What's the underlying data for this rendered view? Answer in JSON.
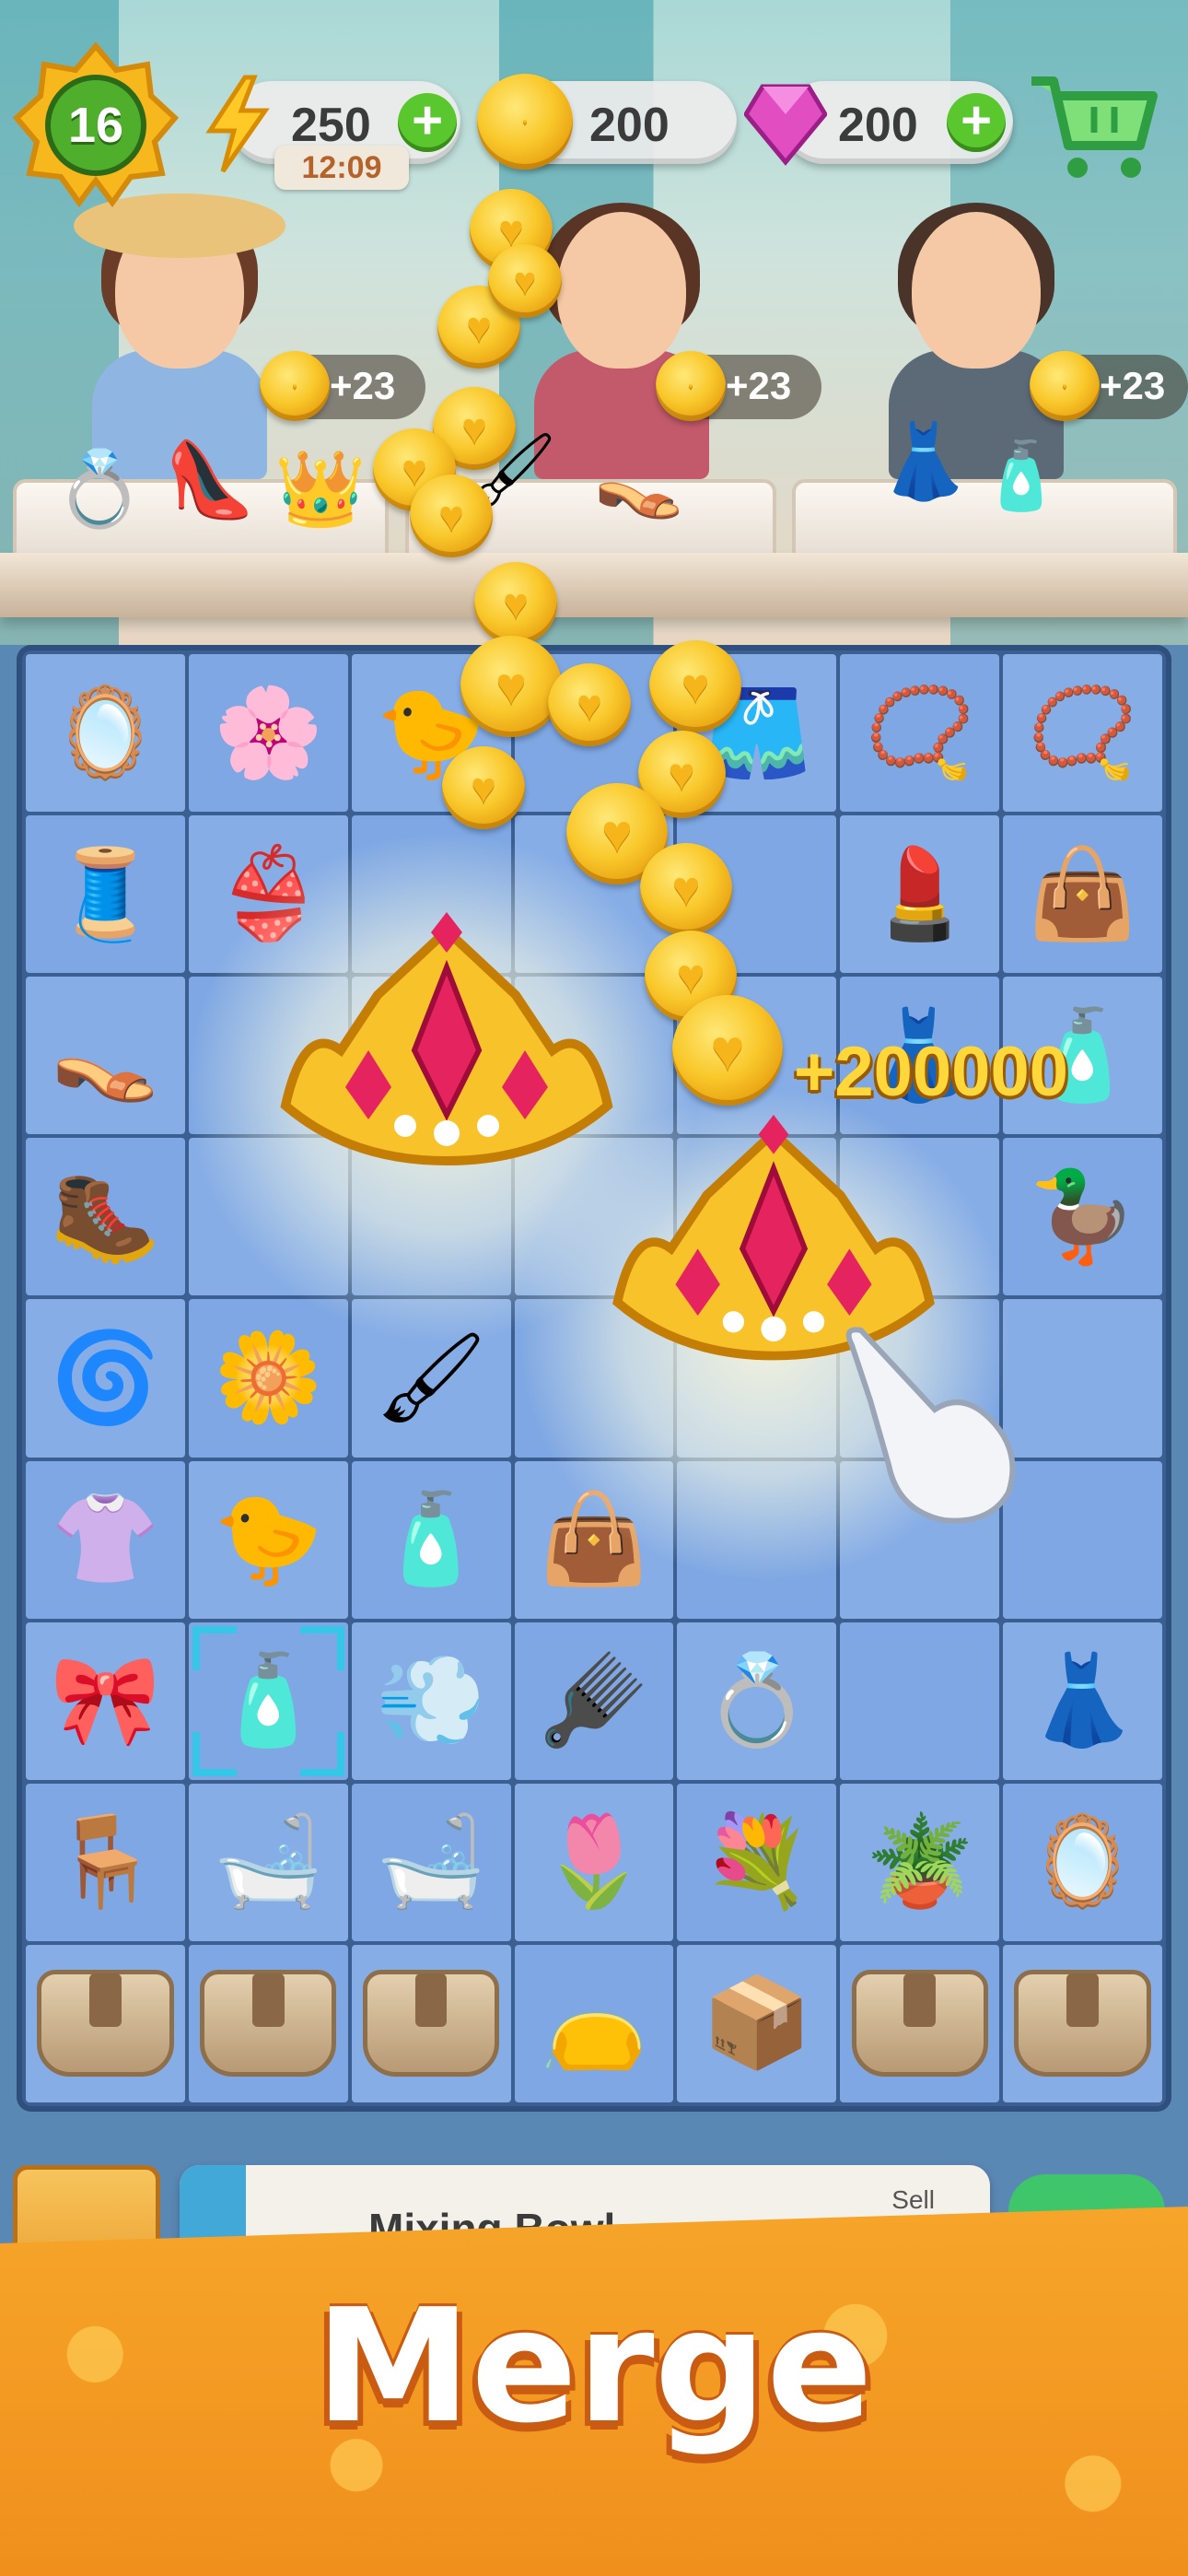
{
  "hud": {
    "level": "16",
    "energy": "250",
    "energy_timer": "12:09",
    "coins": "200",
    "gems": "200"
  },
  "customers": [
    {
      "reward": "+23"
    },
    {
      "reward": "+23"
    },
    {
      "reward": "+23"
    }
  ],
  "board": {
    "bonus": "+200000",
    "icons": {
      "r0": [
        "compact-powder-icon",
        "flower-icon",
        "rubber-duck-icon",
        "",
        "skirt-icon",
        "earrings-icon",
        "pearl-bracelet-icon"
      ],
      "r1": [
        "thread-spool-icon",
        "bra-icon",
        "",
        "",
        "",
        "lipstick-icon",
        "handbag-icon"
      ],
      "r2": [
        "sandals-icon",
        "",
        "",
        "",
        "",
        "dress-icon",
        "perfume-icon"
      ],
      "r3": [
        "boots-icon",
        "",
        "",
        "",
        "",
        "",
        "duck-float-icon"
      ],
      "r4": [
        "flower-clip-icon",
        "flower-compact-icon",
        "brush-icon",
        "",
        "",
        "",
        ""
      ],
      "r5": [
        "blouse-icon",
        "rubber-duck-icon",
        "perfume-icon",
        "handbag-icon",
        "",
        "",
        ""
      ],
      "r6": [
        "perfume-bottle-icon",
        "perfume-icon",
        "hair-dryer-icon",
        "hairbrush-icon",
        "ring-icon",
        "",
        "sequin-dress-icon"
      ],
      "r7": [
        "folding-stool-icon",
        "bathtub-icon",
        "bathtub-icon",
        "flower-pots-icon",
        "flower-stand-icon",
        "plant-shelf-icon",
        "compact-mirror-icon"
      ],
      "r8": [
        "basket-icon",
        "basket-icon",
        "basket-icon",
        "cosmetic-bag-icon",
        "box-icon",
        "basket-icon",
        "basket-icon"
      ]
    }
  },
  "info_panel": {
    "title": "Mixing Bowl",
    "sell_label": "Sell"
  },
  "banner": {
    "title": "Merge"
  },
  "colors": {
    "board_bg": "#3b5f91",
    "cell_bg": "#7ea7e3",
    "banner_orange": "#f6a52a",
    "plus_green": "#5bc72f",
    "gold": "#f9c82b"
  }
}
